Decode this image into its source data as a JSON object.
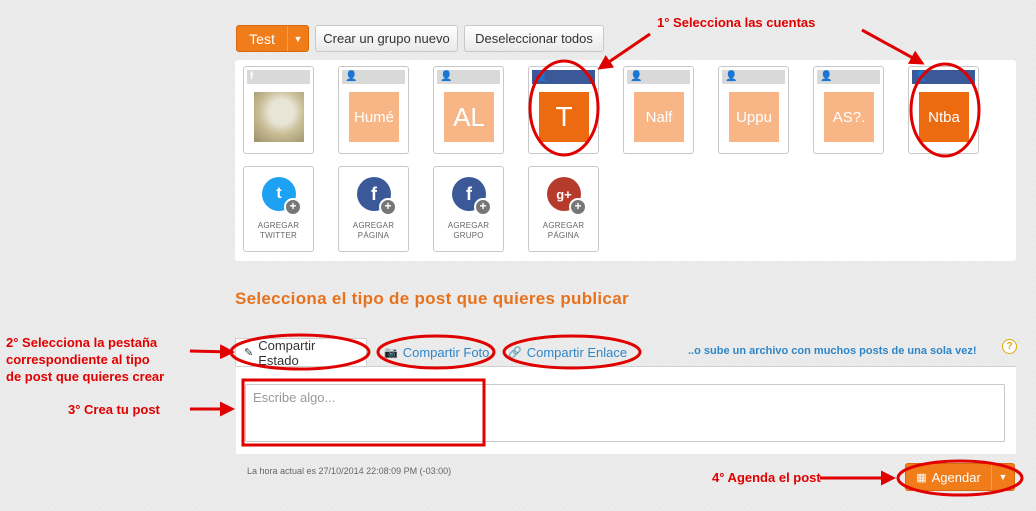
{
  "toolbar": {
    "group_button_label": "Test",
    "dropdown_caret": "▼",
    "create_group_label": "Crear un grupo nuevo",
    "deselect_all_label": "Deseleccionar todos"
  },
  "accounts": [
    {
      "type": "facebook",
      "badge": "f",
      "avatar_kind": "photo",
      "label": "",
      "selected": false
    },
    {
      "type": "page",
      "badge": "👤",
      "avatar_kind": "initials",
      "label": "Humé",
      "selected": false
    },
    {
      "type": "page",
      "badge": "👤",
      "avatar_kind": "initials",
      "label": "AL",
      "selected": false
    },
    {
      "type": "page",
      "badge": "👤",
      "avatar_kind": "initials",
      "label": "T",
      "selected": true
    },
    {
      "type": "page",
      "badge": "👤",
      "avatar_kind": "initials",
      "label": "Nalf",
      "selected": false
    },
    {
      "type": "page",
      "badge": "👤",
      "avatar_kind": "initials",
      "label": "Uppu",
      "selected": false
    },
    {
      "type": "page",
      "badge": "👤",
      "avatar_kind": "initials",
      "label": "AS?.",
      "selected": false
    },
    {
      "type": "page",
      "badge": "👤",
      "avatar_kind": "initials",
      "label": "Ntba",
      "selected": true
    }
  ],
  "add_accounts": [
    {
      "network": "twitter",
      "glyph": "t",
      "color": "#1da1f2",
      "line1": "AGREGAR",
      "line2": "TWITTER"
    },
    {
      "network": "facebook",
      "glyph": "f",
      "color": "#3b5998",
      "line1": "AGREGAR",
      "line2": "PÁGINA"
    },
    {
      "network": "facebook",
      "glyph": "f",
      "color": "#3b5998",
      "line1": "AGREGAR",
      "line2": "GRUPO"
    },
    {
      "network": "google-plus",
      "glyph": "g+",
      "color": "#b53b2c",
      "line1": "AGREGAR",
      "line2": "PÁGINA"
    }
  ],
  "add_plus_glyph": "+",
  "section_heading": "Selecciona el tipo de post que quieres publicar",
  "tabs": [
    {
      "label": "Compartir Estado",
      "icon": "edit-icon",
      "glyph": "✎",
      "active": true
    },
    {
      "label": "Compartir Foto",
      "icon": "camera-icon",
      "glyph": "📷",
      "active": false
    },
    {
      "label": "Compartir Enlace",
      "icon": "link-icon",
      "glyph": "🔗",
      "active": false
    }
  ],
  "upload_link": "..o sube un archivo con muchos posts de una sola vez!",
  "help_glyph": "?",
  "post": {
    "placeholder": "Escribe algo...",
    "time_note": "La hora actual es 27/10/2014 22:08:09 PM (-03:00)"
  },
  "schedule": {
    "label": "Agendar",
    "icon_glyph": "▦"
  },
  "annotations": {
    "step1": "1° Selecciona las cuentas",
    "step2_line1": "2° Selecciona la pestaña",
    "step2_line2": "correspondiente al tipo",
    "step2_line3": "de post que quieres crear",
    "step3": "3° Crea tu post",
    "step4": "4° Agenda el post"
  },
  "colors": {
    "brand_orange": "#f07c1a",
    "light_orange": "#f8b686",
    "facebook_blue": "#3b5998",
    "link_blue": "#2e86c8",
    "annotation_red": "#e00000"
  }
}
